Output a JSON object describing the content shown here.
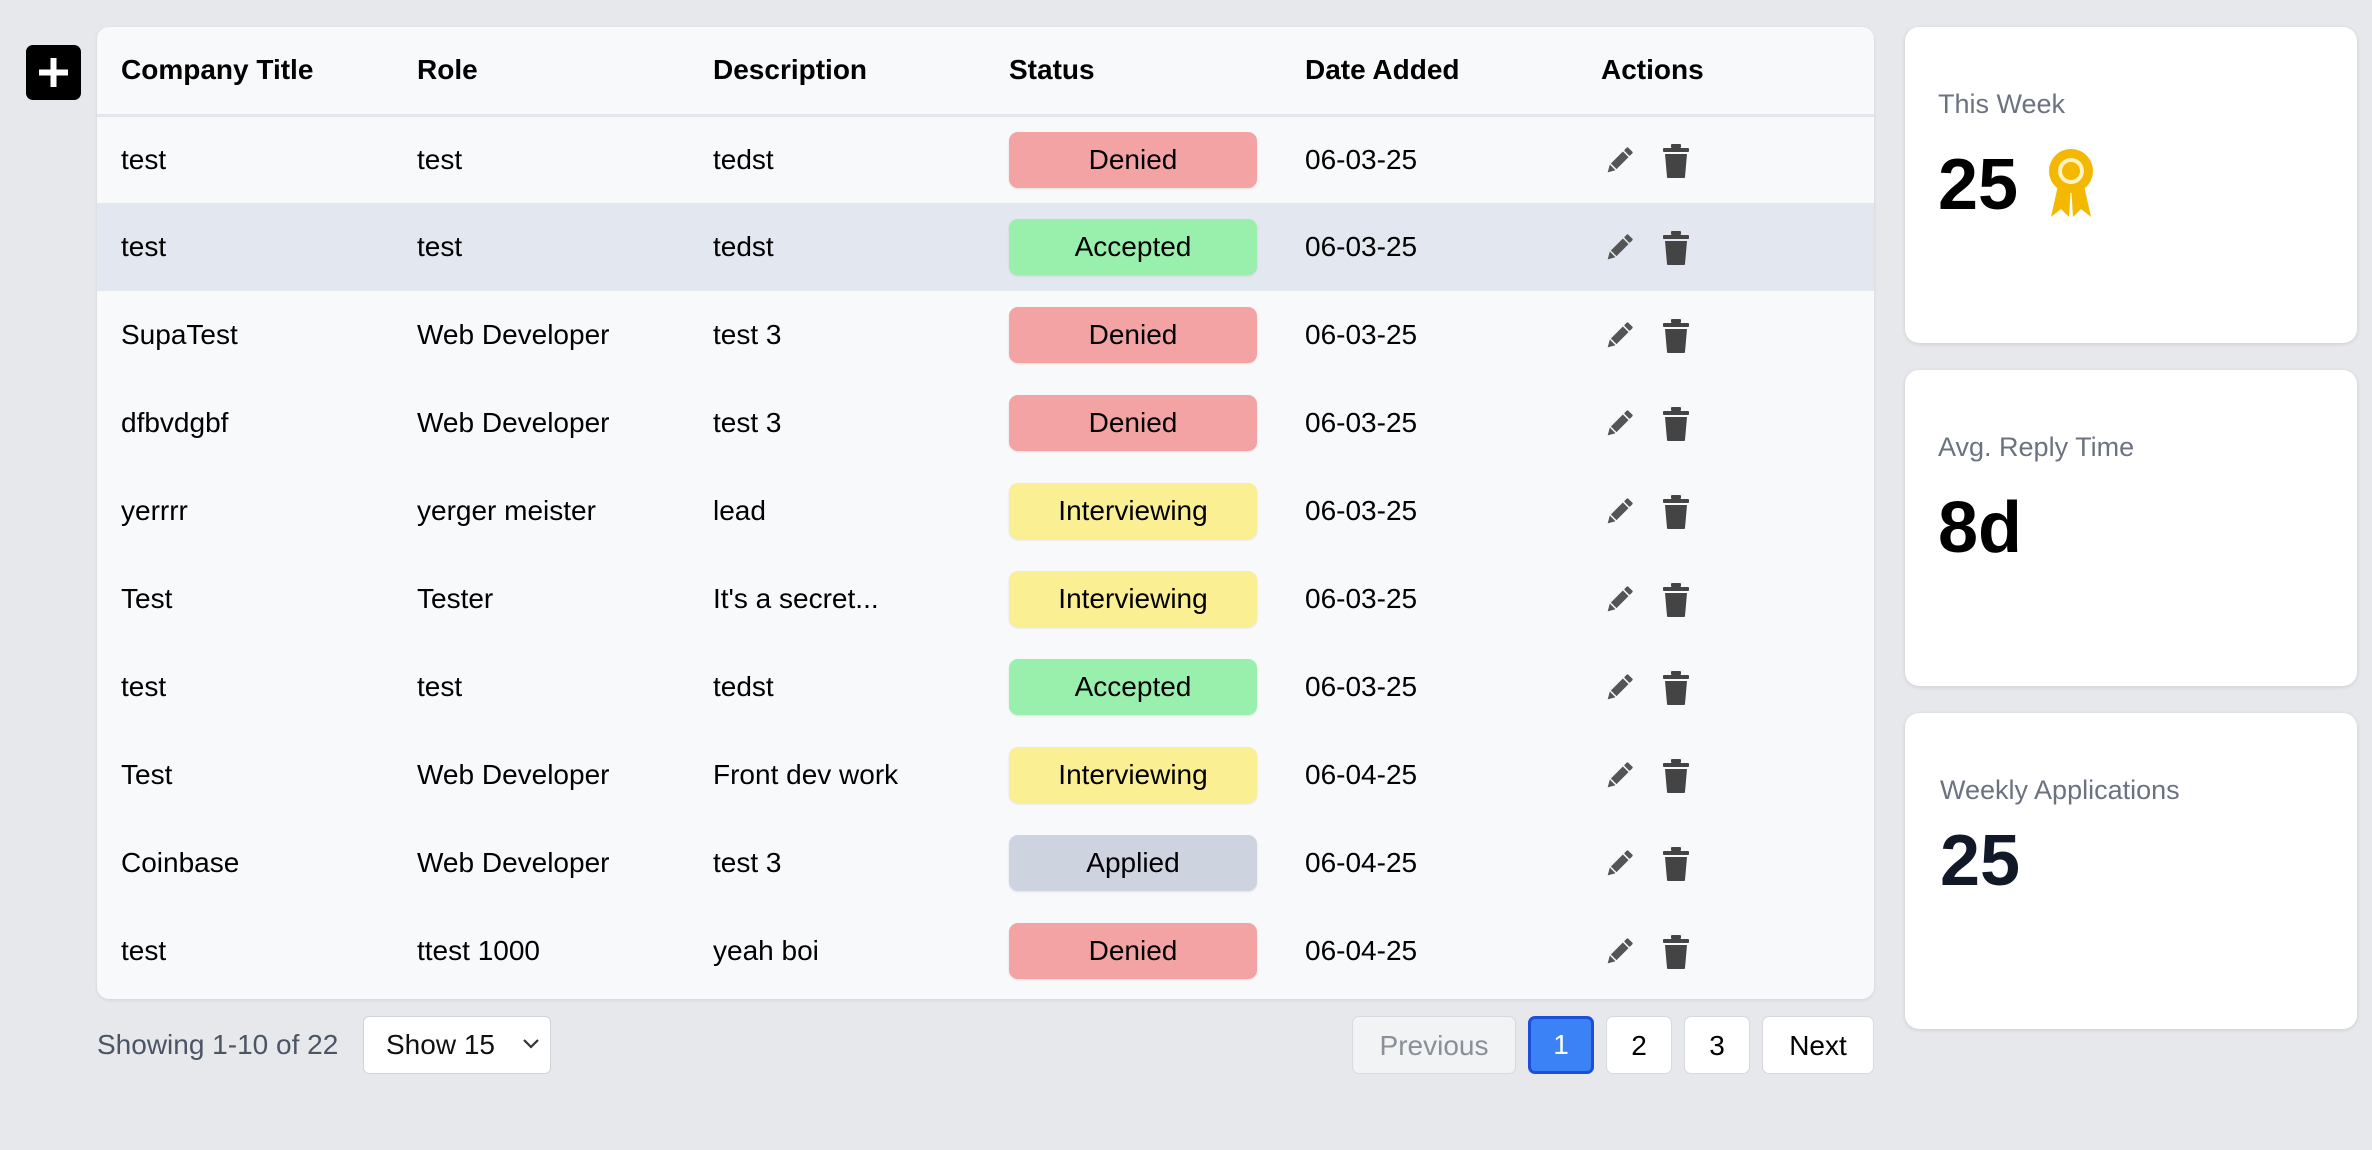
{
  "table": {
    "headers": [
      "Company Title",
      "Role",
      "Description",
      "Status",
      "Date Added",
      "Actions"
    ],
    "rows": [
      {
        "company": "test",
        "role": "test",
        "description": "tedst",
        "status": "Denied",
        "date": "06-03-25"
      },
      {
        "company": "test",
        "role": "test",
        "description": "tedst",
        "status": "Accepted",
        "date": "06-03-25"
      },
      {
        "company": "SupaTest",
        "role": "Web Developer",
        "description": "test 3",
        "status": "Denied",
        "date": "06-03-25"
      },
      {
        "company": "dfbvdgbf",
        "role": "Web Developer",
        "description": "test 3",
        "status": "Denied",
        "date": "06-03-25"
      },
      {
        "company": "yerrrr",
        "role": "yerger meister",
        "description": "lead",
        "status": "Interviewing",
        "date": "06-03-25"
      },
      {
        "company": "Test",
        "role": "Tester",
        "description": "It's a secret...",
        "status": "Interviewing",
        "date": "06-03-25"
      },
      {
        "company": "test",
        "role": "test",
        "description": "tedst",
        "status": "Accepted",
        "date": "06-03-25"
      },
      {
        "company": "Test",
        "role": "Web Developer",
        "description": "Front dev work",
        "status": "Interviewing",
        "date": "06-04-25"
      },
      {
        "company": "Coinbase",
        "role": "Web Developer",
        "description": "test 3",
        "status": "Applied",
        "date": "06-04-25"
      },
      {
        "company": "test",
        "role": "ttest 1000",
        "description": "yeah boi",
        "status": "Denied",
        "date": "06-04-25"
      }
    ]
  },
  "status_colors": {
    "Denied": "#f3a3a3",
    "Accepted": "#99efac",
    "Interviewing": "#fbef93",
    "Applied": "#cdd4e0"
  },
  "icons": {
    "add": "plus-icon",
    "edit": "pencil-icon",
    "delete": "trash-icon",
    "select": "chevron-down-icon",
    "award": "award-ribbon-icon"
  },
  "footer": {
    "showing": "Showing 1-10 of 22",
    "page_size": "Show 15",
    "prev_label": "Previous",
    "pages": [
      "1",
      "2",
      "3"
    ],
    "active_page": "1",
    "next_label": "Next"
  },
  "stats": {
    "this_week": {
      "label": "This Week",
      "value": "25"
    },
    "avg_reply": {
      "label": "Avg. Reply Time",
      "value": "8d"
    },
    "weekly_apps": {
      "label": "Weekly Applications",
      "value": "25"
    }
  },
  "colors": {
    "accent": "#3b82f6",
    "award": "#f5b800"
  }
}
